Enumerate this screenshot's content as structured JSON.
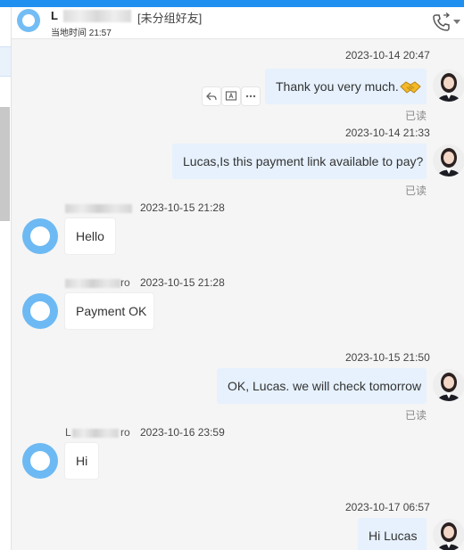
{
  "header": {
    "name_visible": "L",
    "group_label": "[未分组好友]",
    "local_time_label": "当地时间 21:57"
  },
  "messages": {
    "m1": {
      "timestamp": "2023-10-14 20:47",
      "text": "Thank you very much.",
      "emoji": "handshake",
      "status": "已读"
    },
    "m2": {
      "timestamp": "2023-10-14 21:33",
      "text": "Lucas,Is this payment link available to pay?",
      "status": "已读"
    },
    "m3": {
      "timestamp": "2023-10-15 21:28",
      "text": "Hello"
    },
    "m4": {
      "sender_suffix": "ro",
      "timestamp": "2023-10-15 21:28",
      "text": "Payment OK"
    },
    "m5": {
      "timestamp": "2023-10-15 21:50",
      "text": "OK, Lucas. we will check tomorrow",
      "status": "已读"
    },
    "m6": {
      "sender_initial": "L",
      "sender_suffix": "ro",
      "timestamp": "2023-10-16 23:59",
      "text": "Hi"
    },
    "m7": {
      "timestamp": "2023-10-17 06:57",
      "text": "Hi Lucas"
    }
  },
  "colors": {
    "accent": "#1f8ff0",
    "outgoing_bubble": "#e6f1fd",
    "incoming_avatar": "#6db9f3"
  },
  "icons": [
    "call-icon",
    "reply-icon",
    "translate-icon",
    "more-icon"
  ]
}
